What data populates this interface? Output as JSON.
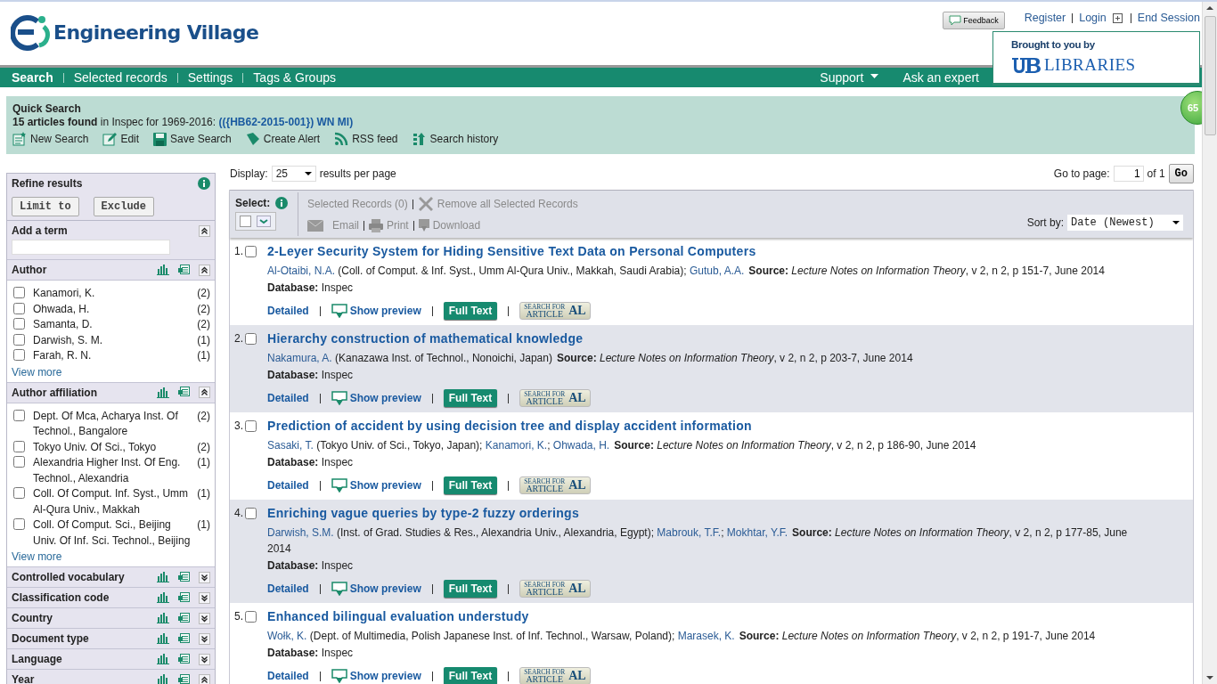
{
  "header": {
    "brand": "Engineering Village",
    "feedback": "Feedback",
    "links": [
      {
        "label": "Register",
        "kind": "plain"
      },
      {
        "label": "Login",
        "kind": "plus"
      },
      {
        "label": "End Session",
        "kind": "plain"
      }
    ],
    "sponsor": {
      "caption": "Brought to you by",
      "name": "LIBRARIES"
    }
  },
  "nav": {
    "items": [
      {
        "label": "Search",
        "selected": true
      },
      {
        "label": "Selected records",
        "selected": false
      },
      {
        "label": "Settings",
        "selected": false
      },
      {
        "label": "Tags & Groups",
        "selected": false
      }
    ],
    "right": [
      {
        "label": "Support",
        "dropdown": true
      },
      {
        "label": "Ask an expert",
        "dropdown": false
      }
    ]
  },
  "quick_search": {
    "title": "Quick Search",
    "summary": "**15 articles found** in Inspec for 1969-2016: ",
    "query": "(({HB62-2015-001}) WN MI)",
    "actions": [
      {
        "label": "New Search",
        "kind": "new"
      },
      {
        "label": "Edit",
        "kind": "edit"
      },
      {
        "label": "Save Search",
        "kind": "save"
      },
      {
        "label": "Create Alert",
        "kind": "alert"
      },
      {
        "label": "RSS feed",
        "kind": "rss"
      },
      {
        "label": "Search history",
        "kind": "history"
      }
    ]
  },
  "refine": {
    "title": "Refine results",
    "limit": "Limit to",
    "exclude": "Exclude",
    "add_term": {
      "label": "Add a term",
      "expanded": true
    },
    "facets": [
      {
        "title": "Author",
        "expanded": true,
        "items": [
          {
            "label": "Kanamori, K.",
            "count": "(2)",
            "checked": false
          },
          {
            "label": "Ohwada, H.",
            "count": "(2)",
            "checked": false
          },
          {
            "label": "Samanta, D.",
            "count": "(2)",
            "checked": false
          },
          {
            "label": "Darwish, S. M.",
            "count": "(1)",
            "checked": false
          },
          {
            "label": "Farah, R. N.",
            "count": "(1)",
            "checked": false
          }
        ],
        "more": "View more"
      },
      {
        "title": "Author affiliation",
        "expanded": true,
        "items": [
          {
            "label": "Dept. Of Mca, Acharya Inst. Of Technol., Bangalore",
            "count": "(2)",
            "checked": false
          },
          {
            "label": "Tokyo Univ. Of Sci., Tokyo",
            "count": "(2)",
            "checked": false
          },
          {
            "label": "Alexandria Higher Inst. Of Eng. Technol., Alexandria",
            "count": "(1)",
            "checked": false
          },
          {
            "label": "Coll. Of Comput. Inf. Syst., Umm Al-Qura Univ., Makkah",
            "count": "(1)",
            "checked": false
          },
          {
            "label": "Coll. Of Comput. Sci., Beijing Univ. Of Inf. Sci. Technol., Beijing",
            "count": "(1)",
            "checked": false
          }
        ],
        "more": "View more"
      },
      {
        "title": "Controlled vocabulary",
        "expanded": false
      },
      {
        "title": "Classification code",
        "expanded": false
      },
      {
        "title": "Country",
        "expanded": false
      },
      {
        "title": "Document type",
        "expanded": false
      },
      {
        "title": "Language",
        "expanded": false
      },
      {
        "title": "Year",
        "expanded": true
      }
    ]
  },
  "display": {
    "label": "Display:",
    "value": "25",
    "suffix": "results per page"
  },
  "pager": {
    "label": "Go to page:",
    "value": "1",
    "of": "of 1",
    "go": "Go"
  },
  "toolbar": {
    "select": "Select:",
    "selected_records": "Selected Records (0)",
    "remove": "Remove all Selected Records",
    "email": "Email",
    "print": "Print",
    "download": "Download",
    "disabled": true,
    "sort_label": "Sort by:",
    "sort_value": "Date (Newest)"
  },
  "results": [
    {
      "number": "1.",
      "checked": false,
      "title": "2-Leyer Security System for Hiding Sensitive Text Data on Personal Computers",
      "citation": [
        {
          "text": "Al-Otaibi, N.A.",
          "kind": "link"
        },
        {
          "text": " (Coll. of Comput. & Inf. Syst., Umm Al-Qura Univ., Makkah, Saudi Arabia); ",
          "kind": "plain"
        },
        {
          "text": "Gutub, A.A.",
          "kind": "link"
        }
      ],
      "source": "**Source:** *Lecture Notes on Information Theory*, v 2, n 2, p 151-7, June 2014",
      "database": "**Database:** Inspec",
      "actions": {
        "detailed": "Detailed",
        "preview": "Show preview",
        "full_text": "Full Text",
        "linker": {
          "top": "SEARCH FOR",
          "bottom": "ARTICLE",
          "mark": "AL"
        }
      }
    },
    {
      "number": "2.",
      "checked": false,
      "title": "Hierarchy construction of mathematical knowledge",
      "citation": [
        {
          "text": "Nakamura, A.",
          "kind": "link"
        },
        {
          "text": " (Kanazawa Inst. of Technol., Nonoichi, Japan)",
          "kind": "plain"
        }
      ],
      "source": "**Source:** *Lecture Notes on Information Theory*, v 2, n 2, p 203-7, June 2014",
      "database": "**Database:** Inspec",
      "actions": {
        "detailed": "Detailed",
        "preview": "Show preview",
        "full_text": "Full Text",
        "linker": {
          "top": "SEARCH FOR",
          "bottom": "ARTICLE",
          "mark": "AL"
        }
      }
    },
    {
      "number": "3.",
      "checked": false,
      "title": "Prediction of accident by using decision tree and display accident information",
      "citation": [
        {
          "text": "Sasaki, T.",
          "kind": "link"
        },
        {
          "text": " (Tokyo Univ. of Sci., Tokyo, Japan); ",
          "kind": "plain"
        },
        {
          "text": "Kanamori, K.",
          "kind": "link"
        },
        {
          "text": "; ",
          "kind": "plain"
        },
        {
          "text": "Ohwada, H.",
          "kind": "link"
        }
      ],
      "source": "**Source:** *Lecture Notes on Information Theory*, v 2, n 2, p 186-90, June 2014",
      "database": "**Database:** Inspec",
      "actions": {
        "detailed": "Detailed",
        "preview": "Show preview",
        "full_text": "Full Text",
        "linker": {
          "top": "SEARCH FOR",
          "bottom": "ARTICLE",
          "mark": "AL"
        }
      }
    },
    {
      "number": "4.",
      "checked": false,
      "title": "Enriching vague queries by type-2 fuzzy orderings",
      "citation": [
        {
          "text": "Darwish, S.M.",
          "kind": "link"
        },
        {
          "text": " (Inst. of Grad. Studies & Res., Alexandria Univ., Alexandria, Egypt); ",
          "kind": "plain"
        },
        {
          "text": "Mabrouk, T.F.",
          "kind": "link"
        },
        {
          "text": "; ",
          "kind": "plain"
        },
        {
          "text": "Mokhtar, Y.F.",
          "kind": "link"
        }
      ],
      "source": "**Source:** *Lecture Notes on Information Theory*, v 2, n 2, p 177-85, June 2014",
      "database": "**Database:** Inspec",
      "actions": {
        "detailed": "Detailed",
        "preview": "Show preview",
        "full_text": "Full Text",
        "linker": {
          "top": "SEARCH FOR",
          "bottom": "ARTICLE",
          "mark": "AL"
        }
      }
    },
    {
      "number": "5.",
      "checked": false,
      "title": "Enhanced bilingual evaluation understudy",
      "citation": [
        {
          "text": "Wołk, K.",
          "kind": "link"
        },
        {
          "text": " (Dept. of Multimedia, Polish Japanese Inst. of Inf. Technol., Warsaw, Poland); ",
          "kind": "plain"
        },
        {
          "text": "Marasek, K.",
          "kind": "link"
        }
      ],
      "source": "**Source:** *Lecture Notes on Information Theory*, v 2, n 2, p 191-7, June 2014",
      "database": "**Database:** Inspec",
      "actions": {
        "detailed": "Detailed",
        "preview": "Show preview",
        "full_text": "Full Text",
        "linker": {
          "top": "SEARCH FOR",
          "bottom": "ARTICLE",
          "mark": "AL"
        }
      }
    }
  ],
  "badge": "65"
}
